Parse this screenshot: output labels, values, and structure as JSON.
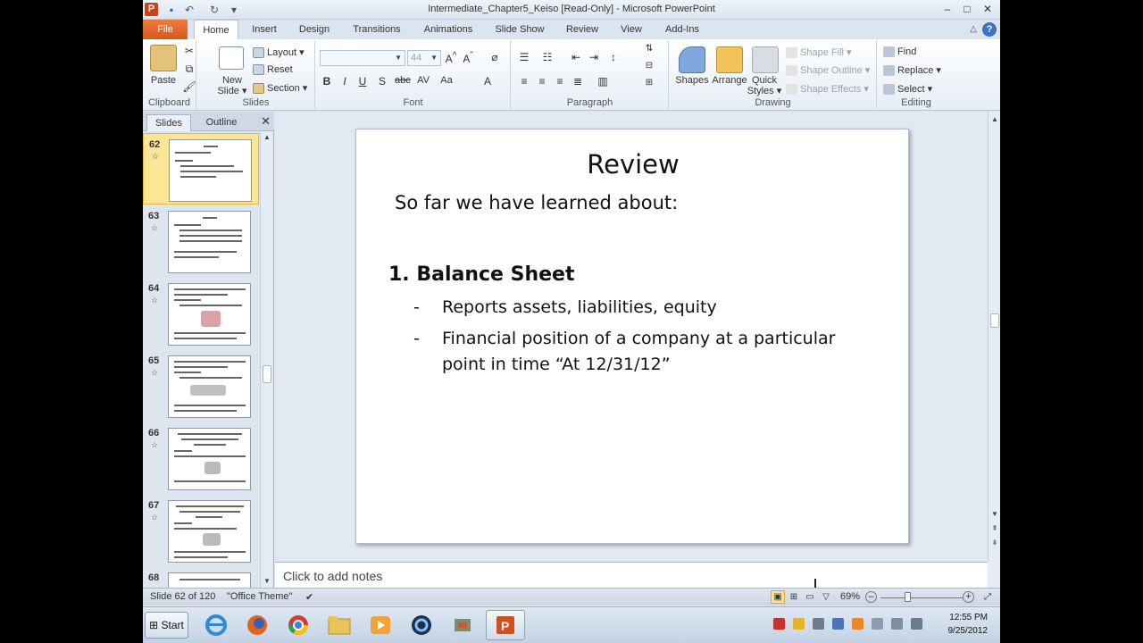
{
  "window": {
    "title": "Intermediate_Chapter5_Keiso [Read-Only]  -  Microsoft PowerPoint",
    "app_letter": "P"
  },
  "tabs": [
    "File",
    "Home",
    "Insert",
    "Design",
    "Transitions",
    "Animations",
    "Slide Show",
    "Review",
    "View",
    "Add-Ins"
  ],
  "ribbon": {
    "clipboard": {
      "paste": "Paste",
      "label": "Clipboard"
    },
    "slides": {
      "new_slide_1": "New",
      "new_slide_2": "Slide ▾",
      "layout": "Layout ▾",
      "reset": "Reset",
      "section": "Section ▾",
      "label": "Slides"
    },
    "font": {
      "size": "44",
      "label": "Font"
    },
    "paragraph": {
      "label": "Paragraph"
    },
    "drawing": {
      "shapes": "Shapes",
      "arrange": "Arrange",
      "quick_1": "Quick",
      "quick_2": "Styles ▾",
      "shape_fill": "Shape Fill ▾",
      "shape_outline": "Shape Outline ▾",
      "shape_effects": "Shape Effects ▾",
      "label": "Drawing"
    },
    "editing": {
      "find": "Find",
      "replace": "Replace ▾",
      "select": "Select ▾",
      "label": "Editing"
    }
  },
  "pane": {
    "tab_slides": "Slides",
    "tab_outline": "Outline",
    "close": "✕",
    "thumbs": [
      "62",
      "63",
      "64",
      "65",
      "66",
      "67",
      "68"
    ]
  },
  "slide": {
    "title": "Review",
    "intro": "So far we have learned about:",
    "heading": "1.  Balance Sheet",
    "bullets": [
      "Reports assets, liabilities, equity",
      "Financial position of a company at a particular point in time “At 12/31/12”"
    ],
    "bullet_dash": "-"
  },
  "notes": {
    "placeholder": "Click to add notes"
  },
  "status": {
    "slide_counter": "Slide 62 of 120",
    "theme": "\"Office Theme\"",
    "zoom": "69%"
  },
  "taskbar": {
    "start": "Start",
    "time": "12:55 PM",
    "date": "9/25/2012"
  },
  "colors": {
    "file_tab": "#d75a1c",
    "selected_thumb": "#fde596",
    "ribbon_bg": "#ffffff"
  }
}
